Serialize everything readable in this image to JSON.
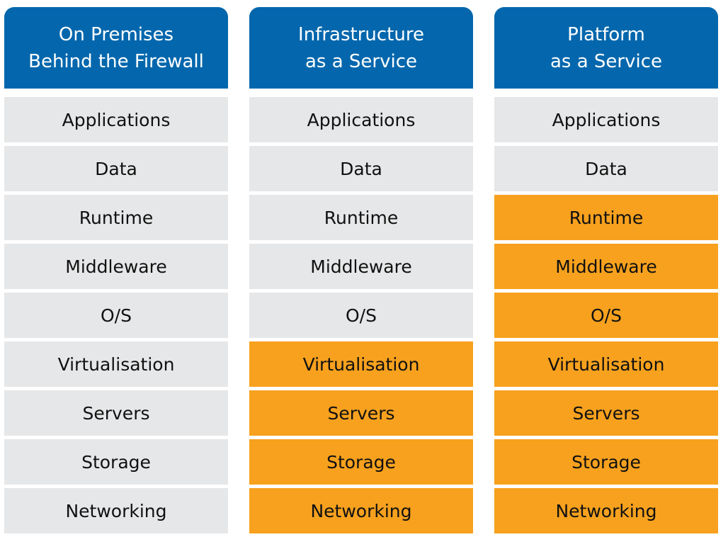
{
  "colors": {
    "header": "#0467ad",
    "self_managed": "#e6e7e8",
    "provider_managed": "#f7a11e"
  },
  "columns": [
    {
      "title_line1": "On Premises",
      "title_line2": "Behind the Firewall",
      "managed_from_index": 9
    },
    {
      "title_line1": "Infrastructure",
      "title_line2": "as a Service",
      "managed_from_index": 5
    },
    {
      "title_line1": "Platform",
      "title_line2": "as a Service",
      "managed_from_index": 2
    }
  ],
  "layers": [
    "Applications",
    "Data",
    "Runtime",
    "Middleware",
    "O/S",
    "Virtualisation",
    "Servers",
    "Storage",
    "Networking"
  ]
}
